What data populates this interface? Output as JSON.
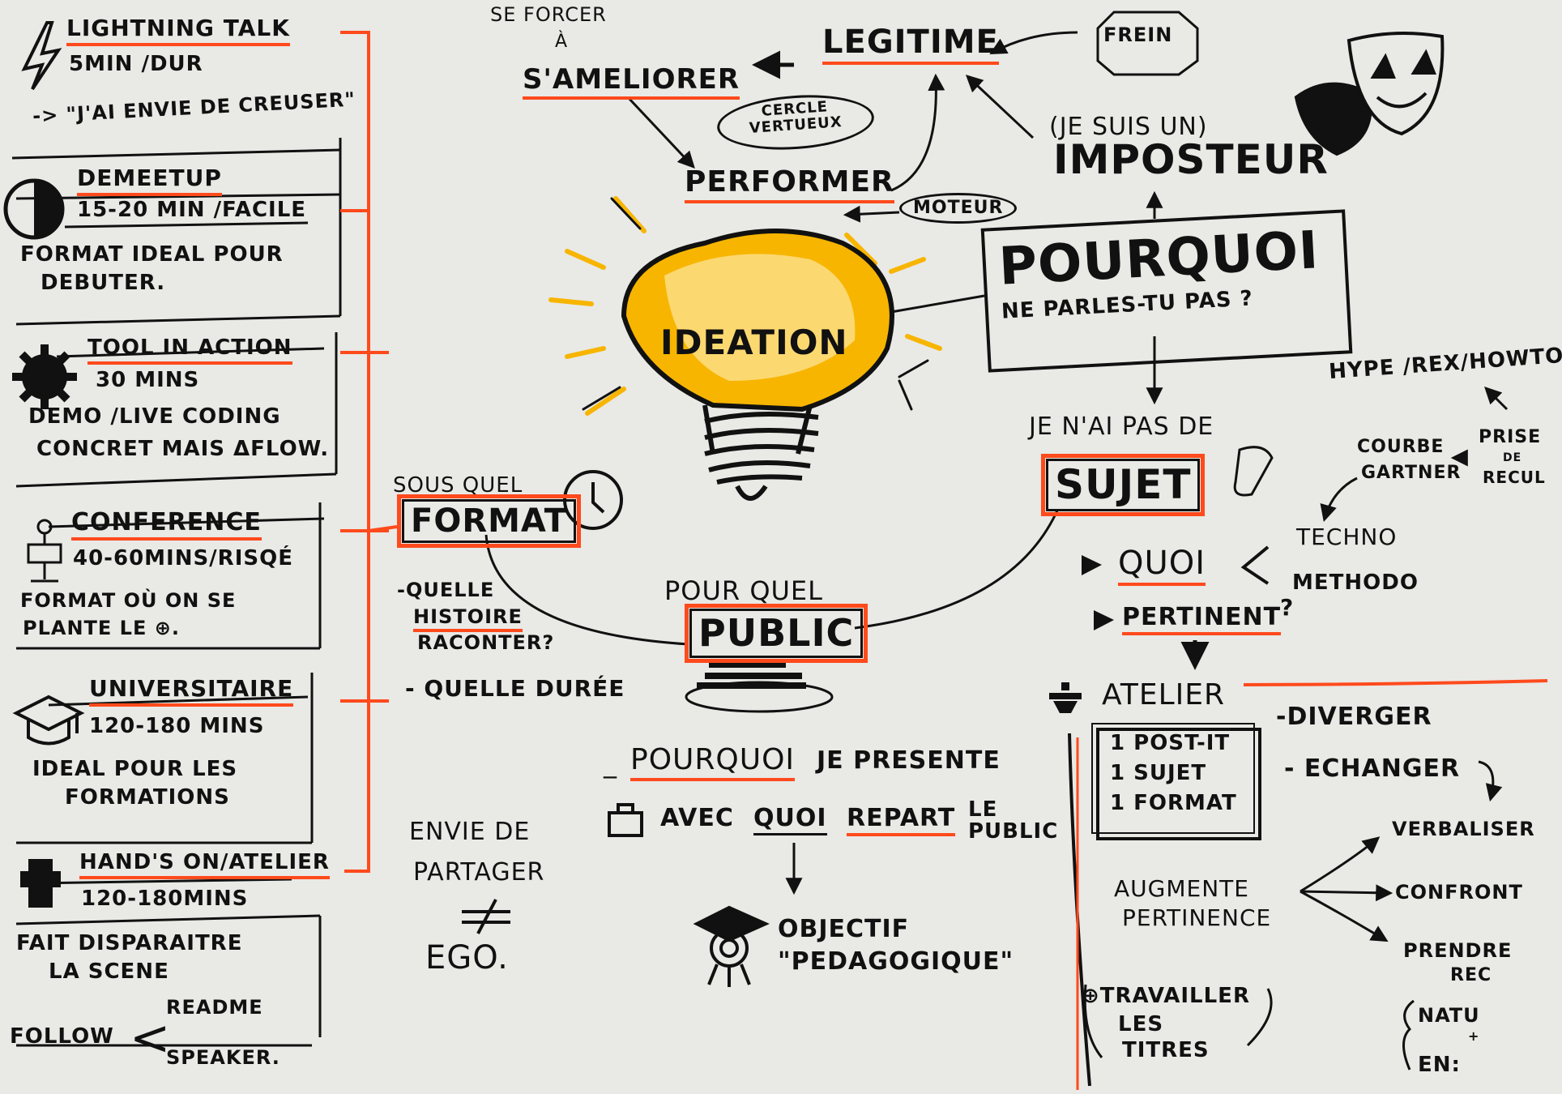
{
  "formats": [
    {
      "title": "LIGHTNING TALK",
      "duration": "5MIN /DUR",
      "desc": [
        "-> \"J'AI ENVIE DE CREUSER\""
      ],
      "icon": "lightning-icon"
    },
    {
      "title": "DEMEETUP",
      "duration": "15-20 MIN /FACILE",
      "desc": [
        "FORMAT IDEAL POUR",
        "DEBUTER."
      ],
      "icon": "half-moon-icon"
    },
    {
      "title": "TOOL IN ACTION",
      "duration": "30 MINS",
      "desc": [
        "DEMO /LIVE CODING",
        "CONCRET MAIS ΔFLOW."
      ],
      "icon": "gear-icon"
    },
    {
      "title": "CONFERENCE",
      "duration": "40-60MINS/RISQÉ",
      "desc": [
        "FORMAT OÙ ON SE",
        "PLANTE LE ⊕."
      ],
      "icon": "speaker-podium-icon"
    },
    {
      "title": "UNIVERSITAIRE",
      "duration": "120-180 MINS",
      "desc": [
        "IDEAL POUR LES",
        "FORMATIONS"
      ],
      "icon": "graduation-cap-icon"
    },
    {
      "title": "HAND'S ON/ATELIER",
      "duration": "120-180MINS",
      "desc": [
        "FAIT DISPARAITRE",
        "LA SCENE"
      ],
      "icon": "hand-icon"
    }
  ],
  "follow": {
    "label": "FOLLOW",
    "items": [
      "README",
      "SPEAKER."
    ]
  },
  "top": {
    "se_forcer": "SE FORCER",
    "a": "À",
    "s_ameliorer": "S'AMELIORER",
    "legitime": "LEGITIME",
    "frein": "FREIN",
    "cercle": [
      "CERCLE",
      "VERTUEUX"
    ],
    "performer": "PERFORMER",
    "moteur": "MOTEUR",
    "je_suis_un": "(JE SUIS UN)",
    "imposteur": "IMPOSTEUR"
  },
  "center": {
    "ideation": "IDEATION",
    "pourquoi": "POURQUOI",
    "ne_parles": "NE PARLES-TU PAS ?"
  },
  "format_node": {
    "sous_quel": "SOUS QUEL",
    "format": "FORMAT"
  },
  "public_node": {
    "pour_quel": "POUR QUEL",
    "public": "PUBLIC"
  },
  "questions": {
    "histoire": [
      "-QUELLE",
      "HISTOIRE",
      "RACONTER?"
    ],
    "duree": "- QUELLE DURÉE"
  },
  "pourquoi_presente": {
    "pourquoi": "POURQUOI",
    "rest": "JE PRESENTE"
  },
  "avec_quoi": {
    "avec": "AVEC",
    "quoi": "QUOI",
    "repart": "REPART",
    "le_public": [
      "LE",
      "PUBLIC"
    ]
  },
  "objectif": [
    "OBJECTIF",
    "\"PEDAGOGIQUE\""
  ],
  "envie": [
    "ENVIE DE",
    "PARTAGER",
    "≠",
    "EGO."
  ],
  "sujet_node": {
    "je_nai": "JE N'AI PAS DE",
    "sujet": "SUJET"
  },
  "hype": "HYPE /REX/HOWTO",
  "prise": [
    "PRISE",
    "DE",
    "RECUL"
  ],
  "courbe": [
    "COURBE",
    "GARTNER"
  ],
  "techno": "TECHNO",
  "methodo": "METHODO",
  "quoi": "QUOI",
  "pertinent": "PERTINENT",
  "atelier": {
    "title": "ATELIER",
    "box": [
      "1 POST-IT",
      "1 SUJET",
      "1 FORMAT"
    ],
    "diverger": "-DIVERGER",
    "echanger": "- ECHANGER",
    "augmente": [
      "AUGMENTE",
      "PERTINENCE"
    ],
    "verbaliser": "VERBALISER",
    "confront": "CONFRONT",
    "prendre": [
      "PRENDRE",
      "REC"
    ],
    "nature": [
      "NATU",
      "+",
      "EN:"
    ],
    "travailler": [
      "⊕TRAVAILLER",
      "LES",
      "TITRES"
    ]
  },
  "colors": {
    "accent": "#ff4a1c",
    "ink": "#111111",
    "bulb": "#f7b500",
    "paper": "#e9e9e6"
  }
}
